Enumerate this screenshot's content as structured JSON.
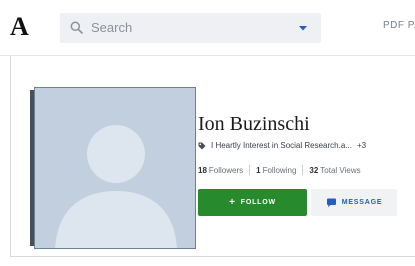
{
  "header": {
    "logo_text": "A",
    "search": {
      "placeholder": "Search"
    },
    "nav_partial": "PDF PA"
  },
  "profile": {
    "name": "Ion Buzinschi",
    "tagline": "I Heartly Interest in Social Research.a...",
    "tagline_more": "+3",
    "stats": {
      "followers_count": "18",
      "followers_label": "Followers",
      "following_count": "1",
      "following_label": "Following",
      "views_count": "32",
      "views_label": "Total Views"
    },
    "buttons": {
      "follow_label": "FOLLOW",
      "message_label": "MESSAGE"
    }
  },
  "icons": {
    "search": "search-icon",
    "dropdown": "chevron-down-icon",
    "tag": "tag-icon",
    "plus": "plus-icon",
    "chat": "chat-bubble-icon",
    "avatar": "default-avatar"
  },
  "colors": {
    "follow_button": "#278a2d",
    "message_text": "#1e5fbf",
    "dropdown_caret": "#1e5fbf",
    "avatar_bg": "#c2cfde"
  }
}
